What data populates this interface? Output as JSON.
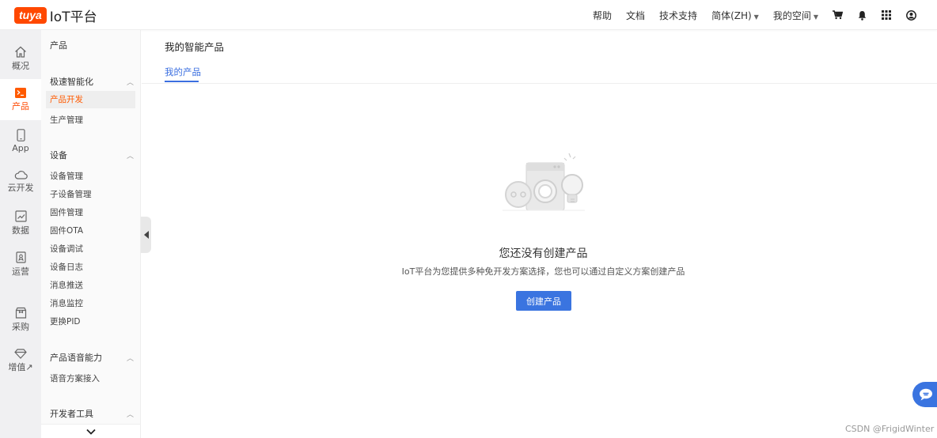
{
  "brand": {
    "badge": "tuya",
    "name": "IoT平台",
    "accent": "#ff4800"
  },
  "topnav": {
    "items": [
      "帮助",
      "文档",
      "技术支持",
      "简体(ZH)",
      "我的空间"
    ],
    "icons": [
      "cart-icon",
      "bell-icon",
      "apps-grid-icon",
      "user-icon"
    ]
  },
  "rail": {
    "items": [
      {
        "label": "概况",
        "icon": "home-icon"
      },
      {
        "label": "产品",
        "icon": "terminal-icon"
      },
      {
        "label": "App",
        "icon": "phone-icon"
      },
      {
        "label": "云开发",
        "icon": "cloud-icon"
      },
      {
        "label": "数据",
        "icon": "chart-icon"
      },
      {
        "label": "运营",
        "icon": "bookmark-icon"
      },
      {
        "label": "采购",
        "icon": "box-icon"
      },
      {
        "label": "增值↗",
        "icon": "diamond-icon"
      }
    ],
    "active_index": 1
  },
  "submenu": {
    "title": "产品",
    "groups": [
      {
        "label": "极速智能化",
        "items": [
          "产品开发",
          "生产管理"
        ]
      },
      {
        "label": "设备",
        "items": [
          "设备管理",
          "子设备管理",
          "固件管理",
          "固件OTA",
          "设备调试",
          "设备日志",
          "消息推送",
          "消息监控",
          "更换PID"
        ]
      },
      {
        "label": "产品语音能力",
        "items": [
          "语音方案接入"
        ]
      },
      {
        "label": "开发者工具",
        "items": []
      }
    ],
    "active_item": "产品开发"
  },
  "main": {
    "page_title": "我的智能产品",
    "tab": "我的产品",
    "empty_title": "您还没有创建产品",
    "empty_desc": "IoT平台为您提供多种免开发方案选择，您也可以通过自定义方案创建产品",
    "create_button": "创建产品",
    "link_color": "#3b6fe0"
  },
  "watermark": "CSDN @FrigidWinter"
}
